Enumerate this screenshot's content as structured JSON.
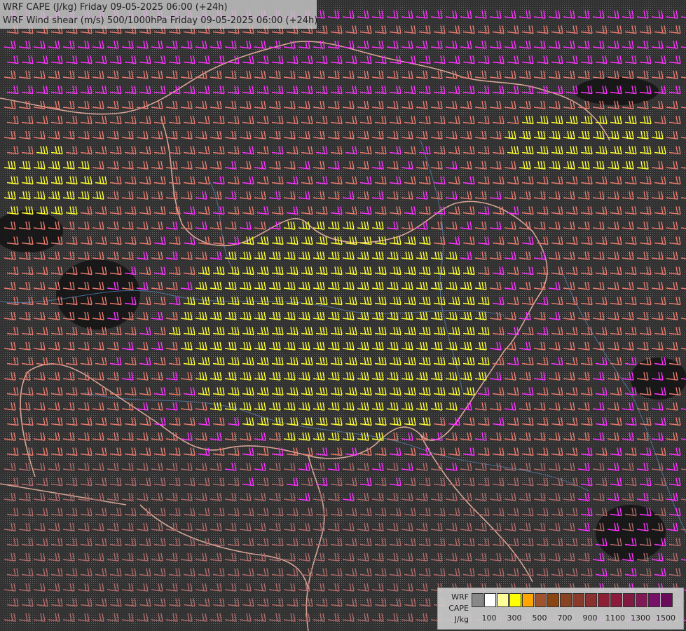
{
  "header": {
    "line1": "WRF CAPE (J/kg) Friday 09-05-2025 06:00 (+24h)",
    "line2": "WRF Wind shear (m/s) 500/1000hPa Friday 09-05-2025 06:00 (+24h)"
  },
  "legend": {
    "label_lines": [
      "WRF",
      "CAPE",
      "J/kg"
    ],
    "colors": [
      "#888888",
      "#ffffff",
      "#ffff99",
      "#ffff00",
      "#ffa500",
      "#a0522d",
      "#8b4513",
      "#884422",
      "#8a3a2a",
      "#8b3030",
      "#8b2035",
      "#8b1a3c",
      "#801a40",
      "#801a55",
      "#78106a",
      "#6a0a5a"
    ],
    "tick_labels": [
      "100",
      "300",
      "500",
      "700",
      "900",
      "1100",
      "1300",
      "1500"
    ]
  },
  "map": {
    "wind_barb_colors": {
      "low": "#e87a6e",
      "medium": "#ff33ff",
      "high": "#ffff33",
      "muted": "#b06a6a"
    },
    "border_color": "#e8b0a0",
    "river_color": "#5a8ac0"
  }
}
